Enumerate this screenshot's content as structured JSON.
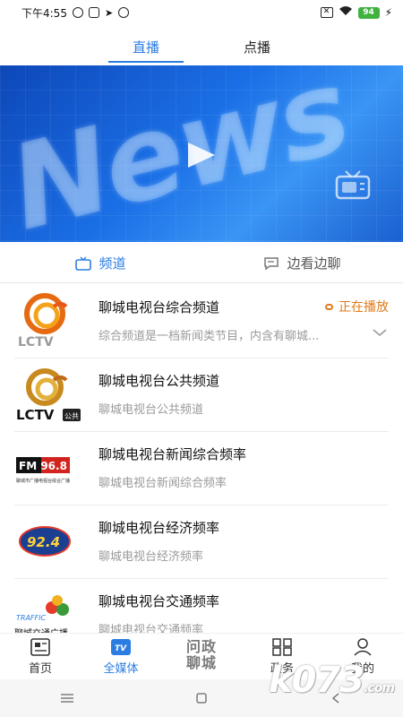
{
  "status_bar": {
    "time": "下午4:55",
    "battery": "94"
  },
  "top_tabs": [
    {
      "label": "直播",
      "active": true
    },
    {
      "label": "点播",
      "active": false
    }
  ],
  "banner": {
    "word": "News"
  },
  "channel_tabs": [
    {
      "label": "频道",
      "icon": "tv-icon",
      "active": true
    },
    {
      "label": "边看边聊",
      "icon": "chat-icon",
      "active": false
    }
  ],
  "channels": [
    {
      "title": "聊城电视台综合频道",
      "desc": "综合频道是一档新闻类节目，内含有聊城...",
      "status": "正在播放",
      "logo_text": "LCTV"
    },
    {
      "title": "聊城电视台公共频道",
      "desc": "聊城电视台公共频道",
      "logo_text": "LCTV",
      "logo_badge": "公共"
    },
    {
      "title": "聊城电视台新闻综合频率",
      "desc": "聊城电视台新闻综合频率",
      "logo_text": "FM 96.8",
      "logo_sub": "聊城市广播电视台综合广播"
    },
    {
      "title": "聊城电视台经济频率",
      "desc": "聊城电视台经济频率",
      "logo_text": "92.4"
    },
    {
      "title": "聊城电视台交通频率",
      "desc": "聊城电视台交通频率",
      "logo_text": "TRAFFIC",
      "logo_sub": "聊城交通广播"
    }
  ],
  "bottom_nav": [
    {
      "label": "首页",
      "icon": "news-icon"
    },
    {
      "label": "全媒体",
      "icon": "tv-badge-icon",
      "active": true
    },
    {
      "label": "问政\n聊城",
      "icon": ""
    },
    {
      "label": "政务",
      "icon": "grid-icon"
    },
    {
      "label": "我的",
      "icon": "person-icon"
    }
  ],
  "watermark": {
    "text": "k073",
    "suffix": ".com"
  },
  "colors": {
    "accent": "#2b7de1",
    "playing": "#e07b1a"
  }
}
